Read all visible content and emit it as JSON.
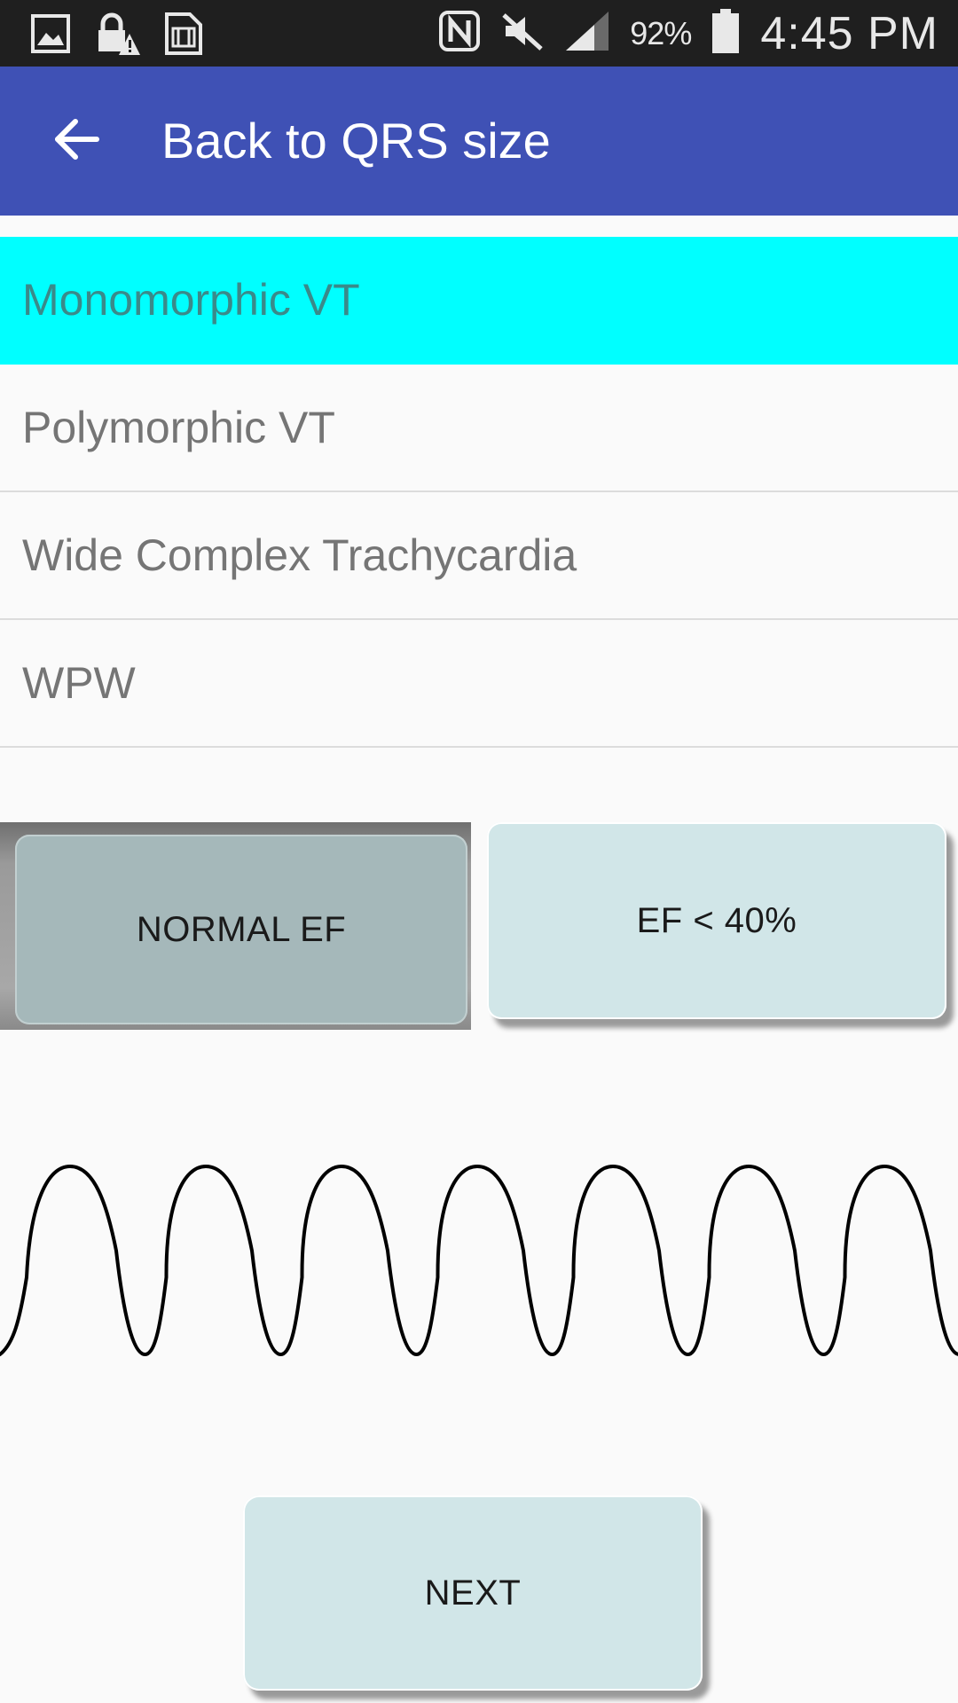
{
  "status_bar": {
    "left_icons": [
      "gallery-icon",
      "lock-alert-icon",
      "sim-card-icon"
    ],
    "right_icons": [
      "nfc-icon",
      "mute-icon",
      "signal-icon",
      "battery-icon"
    ],
    "battery_percent": "92%",
    "time": "4:45 PM"
  },
  "app_bar": {
    "back_icon": "arrow-left-icon",
    "title": "Back to QRS size",
    "color": "#3f51b5"
  },
  "rhythm_list": {
    "items": [
      {
        "label": "Monomorphic VT",
        "selected": true
      },
      {
        "label": "Polymorphic VT",
        "selected": false
      },
      {
        "label": "Wide Complex Trachycardia",
        "selected": false
      },
      {
        "label": "WPW",
        "selected": false
      }
    ],
    "selected_color": "#00ffff"
  },
  "ef_buttons": {
    "normal_label": "NORMAL EF",
    "low_label": "EF < 40%",
    "pressed": "normal"
  },
  "waveform": {
    "description_icon": "ecg-waveform",
    "cycles": 7
  },
  "next_button": {
    "label": "NEXT"
  }
}
